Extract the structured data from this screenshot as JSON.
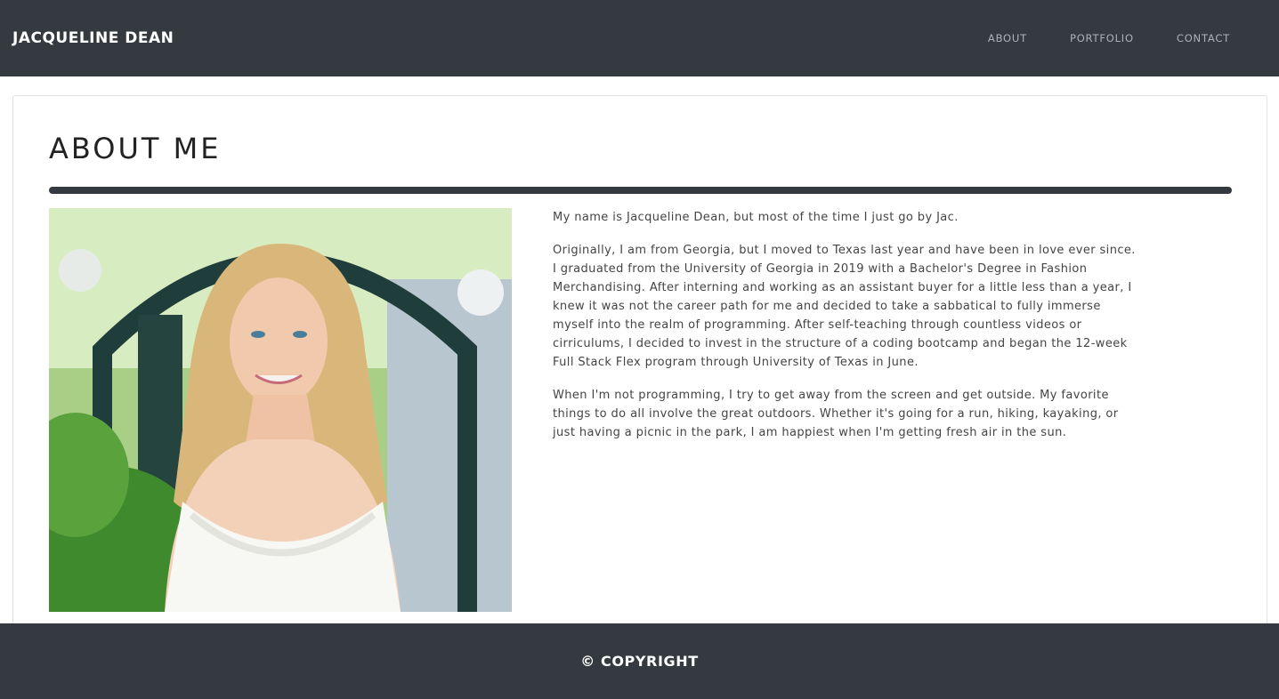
{
  "navbar": {
    "brand": "JACQUELINE DEAN",
    "links": [
      "ABOUT",
      "PORTFOLIO",
      "CONTACT"
    ]
  },
  "about": {
    "title": "ABOUT ME",
    "paragraphs": [
      "My name is Jacqueline Dean, but most of the time I just go by Jac.",
      "Originally, I am from Georgia, but I moved to Texas last year and have been in love ever since. I graduated from the University of Georgia in 2019 with a Bachelor's Degree in Fashion Merchandising. After interning and working as an assistant buyer for a little less than a year, I knew it was not the career path for me and decided to take a sabbatical to fully immerse myself into the realm of programming. After self-teaching through countless videos or cirriculums, I decided to invest in the structure of a coding bootcamp and began the 12-week Full Stack Flex program through University of Texas in June.",
      "When I'm not programming, I try to get away from the screen and get outside. My favorite things to do all involve the great outdoors. Whether it's going for a run, hiking, kayaking, or just having a picnic in the park, I am happiest when I'm getting fresh air in the sun."
    ]
  },
  "footer": {
    "copyright": "© COPYRIGHT"
  },
  "colors": {
    "nav_bg": "#343a40",
    "accent_rule": "#343a40"
  }
}
